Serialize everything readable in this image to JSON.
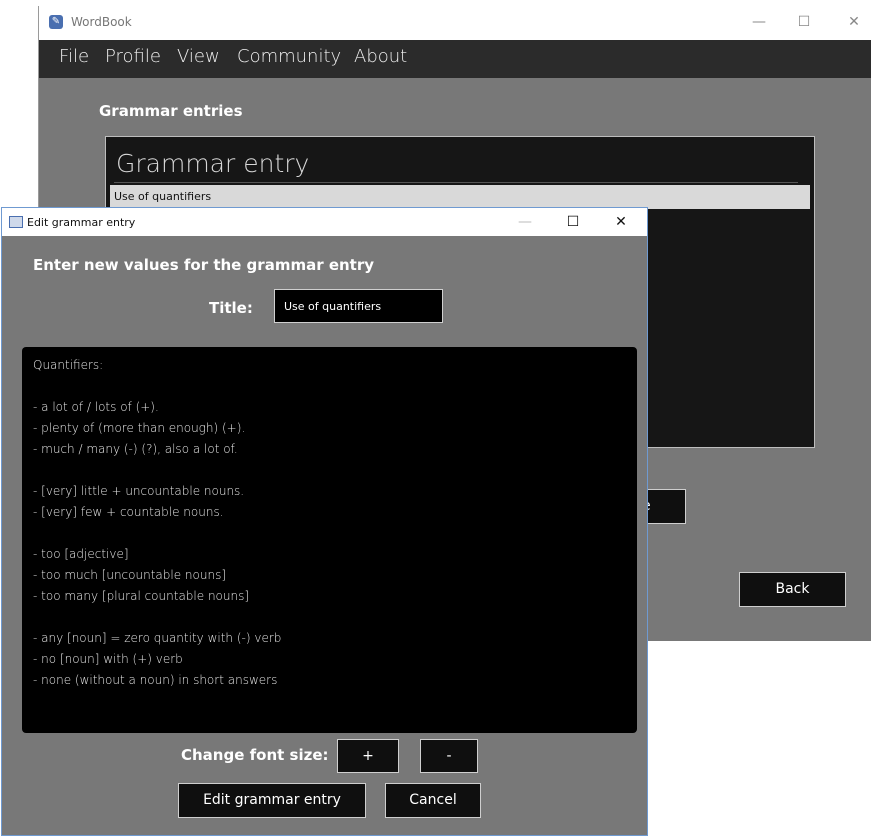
{
  "main_window": {
    "title": "WordBook",
    "controls": {
      "minimize": "—",
      "maximize": "☐",
      "close": "✕"
    },
    "menu": [
      "File",
      "Profile",
      "View",
      "Community",
      "About"
    ],
    "heading": "Grammar entries",
    "panel_header": "Grammar entry",
    "entries": [
      "Use of quantifiers"
    ],
    "partial_button_label": "e",
    "back_button": "Back"
  },
  "dialog": {
    "title": "Edit grammar entry",
    "controls": {
      "minimize": "—",
      "maximize": "☐",
      "close": "✕"
    },
    "instruction": "Enter new values for the grammar entry",
    "title_label": "Title:",
    "title_value": "Use of quantifiers",
    "content_lines": [
      "Quantifiers:",
      "",
      "- a lot of / lots of (+).",
      "- plenty of (more than enough) (+).",
      "- much / many (-) (?), also a lot of.",
      "",
      "- [very] little + uncountable nouns.",
      "- [very] few + countable nouns.",
      "",
      "- too [adjective]",
      "- too much [uncountable nouns]",
      "- too many [plural countable nouns]",
      "",
      "- any [noun] = zero quantity with (-) verb",
      "- no [noun] with (+) verb",
      "- none (without a noun) in short answers"
    ],
    "font_size_label": "Change font size:",
    "font_increase": "+",
    "font_decrease": "-",
    "submit_button": "Edit grammar entry",
    "cancel_button": "Cancel"
  },
  "colors": {
    "window_bg": "#787878",
    "menubar_bg": "#2b2b2b",
    "panel_bg": "#161616",
    "selected_row": "#d9d9d9",
    "content_bg": "#000000"
  }
}
